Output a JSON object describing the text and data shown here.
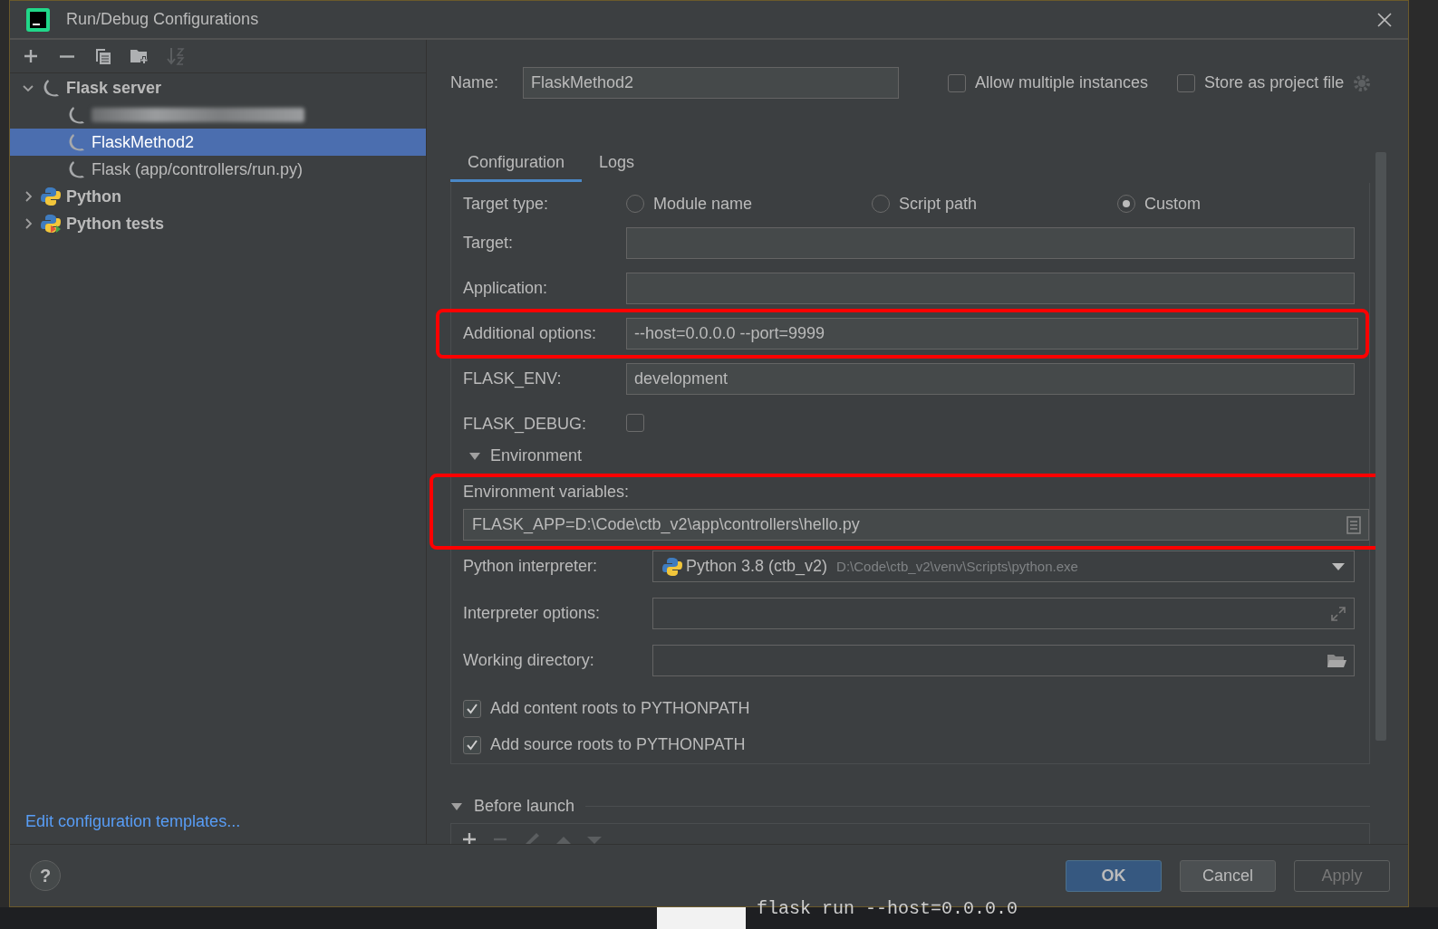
{
  "window": {
    "title": "Run/Debug Configurations"
  },
  "toolbar": [
    {
      "kind": "add",
      "disabled": false
    },
    {
      "kind": "remove",
      "disabled": false
    },
    {
      "kind": "copy",
      "disabled": false
    },
    {
      "kind": "folder",
      "disabled": false
    },
    {
      "kind": "sort",
      "disabled": true
    }
  ],
  "tree": [
    {
      "label": "Flask server",
      "kind": "flask",
      "expanded": true,
      "selected": false,
      "children": [
        {
          "kind": "redacted",
          "selected": false
        },
        {
          "label": "FlaskMethod2",
          "kind": "flask",
          "selected": true
        },
        {
          "label": "Flask (app/controllers/run.py)",
          "kind": "flask",
          "selected": false
        }
      ]
    },
    {
      "label": "Python",
      "kind": "python",
      "expanded": false,
      "selected": false
    },
    {
      "label": "Python tests",
      "kind": "python-tests",
      "expanded": false,
      "selected": false
    }
  ],
  "help": "?",
  "templates_link": "Edit configuration templates...",
  "name": {
    "label": "Name:",
    "value": "FlaskMethod2"
  },
  "options": [
    {
      "label": "Allow multiple instances",
      "checked": false
    },
    {
      "label": "Store as project file",
      "checked": false
    }
  ],
  "tabs": [
    {
      "label": "Configuration",
      "selected": true
    },
    {
      "label": "Logs",
      "selected": false
    }
  ],
  "target_type": {
    "label": "Target type:",
    "options": [
      {
        "label": "Module name",
        "selected": false
      },
      {
        "label": "Script path",
        "selected": false
      },
      {
        "label": "Custom",
        "selected": true
      }
    ]
  },
  "fields": [
    {
      "kind": "text",
      "label": "Target:",
      "highlighted": false
    },
    {
      "kind": "text",
      "label": "Application:",
      "highlighted": false
    },
    {
      "kind": "text",
      "label": "Additional options:",
      "value": "--host=0.0.0.0  --port=9999",
      "highlighted": true
    },
    {
      "kind": "text",
      "label": "FLASK_ENV:",
      "value": "development",
      "highlighted": false
    },
    {
      "kind": "checkbox",
      "label": "FLASK_DEBUG:",
      "checked": false,
      "highlighted": false
    }
  ],
  "environment": {
    "label": "Environment",
    "expanded": true
  },
  "env_vars": {
    "label": "Environment variables:",
    "value": "FLASK_APP=D:\\Code\\ctb_v2\\app\\controllers\\hello.py",
    "highlighted": true
  },
  "interpreter": {
    "label": "Python interpreter:",
    "name": "Python 3.8 (ctb_v2)",
    "path": "D:\\Code\\ctb_v2\\venv\\Scripts\\python.exe"
  },
  "more_fields": [
    {
      "kind": "expand",
      "label": "Interpreter options:"
    },
    {
      "kind": "folder",
      "label": "Working directory:"
    }
  ],
  "checks": [
    {
      "label": "Add content roots to PYTHONPATH",
      "checked": true
    },
    {
      "label": "Add source roots to PYTHONPATH",
      "checked": true
    }
  ],
  "before_launch": {
    "label": "Before launch",
    "expanded": true
  },
  "buttons": [
    {
      "label": "OK",
      "kind": "primary"
    },
    {
      "label": "Cancel",
      "kind": "normal"
    },
    {
      "label": "Apply",
      "kind": "disabled"
    }
  ],
  "terminal_line": "flask run --host=0.0.0.0"
}
